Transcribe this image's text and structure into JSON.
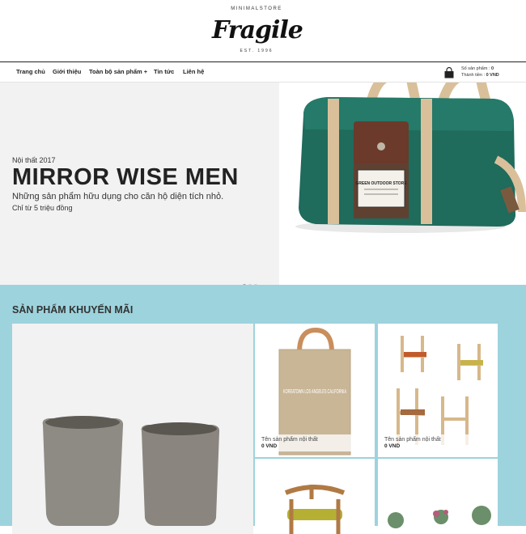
{
  "header": {
    "logo_tag": "MINIMALSTORE",
    "logo_word": "Fragile",
    "logo_est": "EST. 1996"
  },
  "nav": {
    "items": [
      {
        "label": "Trang chủ"
      },
      {
        "label": "Giới thiệu"
      },
      {
        "label": "Toàn bộ sản phẩm +"
      },
      {
        "label": "Tin tức"
      },
      {
        "label": "Liên hệ"
      }
    ]
  },
  "cart": {
    "count_label": "Số sản phẩm :",
    "count_value": "0",
    "total_label": "Thành tiền :",
    "total_value": "0 VND"
  },
  "hero": {
    "eyebrow": "Nội thất 2017",
    "title": "MIRROR WISE MEN",
    "subtitle": "Những sản phẩm hữu dụng cho căn hộ diện tích nhỏ.",
    "price": "Chỉ từ 5 triệu đồng",
    "bag_label": "GREEN OUTDOOR STORE",
    "tote_text": "KOREATOWN LOS ANGELES CALIFORNIA"
  },
  "promo": {
    "title": "SẢN PHẨM KHUYẾN MÃI",
    "products": [
      {
        "name": "Tên sản phẩm nội thất",
        "price": "0 VND"
      },
      {
        "name": "Tên sản phẩm nội thất",
        "price": "0 VND"
      }
    ]
  },
  "colors": {
    "promo_bg": "#9dd3dd",
    "bag_green": "#1f6b5c",
    "bag_brown": "#6b3a2a",
    "strap_tan": "#d9c09a"
  }
}
